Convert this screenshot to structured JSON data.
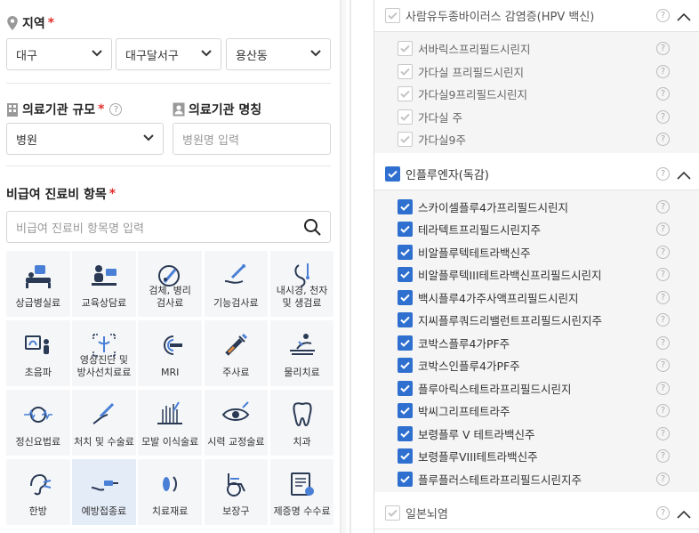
{
  "region": {
    "title": "지역",
    "required_mark": "*",
    "city": "대구",
    "district": "대구달서구",
    "dong": "용산동"
  },
  "facility": {
    "size_title": "의료기관 규모",
    "required_mark": "*",
    "size_value": "병원",
    "name_title": "의료기관 명칭",
    "name_placeholder": "병원명 입력"
  },
  "nonpay": {
    "title": "비급여 진료비 항목",
    "required_mark": "*",
    "search_placeholder": "비급여 진료비 항목명 입력",
    "categories": [
      {
        "label": "상급병실료",
        "icon": "hospital-bed-icon"
      },
      {
        "label": "교육상담료",
        "icon": "counseling-icon"
      },
      {
        "label": "검체, 병리\n검사료",
        "icon": "microscope-icon"
      },
      {
        "label": "기능검사료",
        "icon": "function-test-icon"
      },
      {
        "label": "내시경, 천자\n및 생검료",
        "icon": "endoscope-icon"
      },
      {
        "label": "초음파",
        "icon": "ultrasound-icon"
      },
      {
        "label": "영상진단 및\n방사선치료료",
        "icon": "xray-icon"
      },
      {
        "label": "MRI",
        "icon": "mri-icon"
      },
      {
        "label": "주사료",
        "icon": "syringe-icon"
      },
      {
        "label": "물리치료",
        "icon": "physical-therapy-icon"
      },
      {
        "label": "정신요법료",
        "icon": "brain-icon"
      },
      {
        "label": "처치 및 수술료",
        "icon": "surgery-icon"
      },
      {
        "label": "모발 이식술료",
        "icon": "hair-transplant-icon"
      },
      {
        "label": "시력 교정술료",
        "icon": "eye-icon"
      },
      {
        "label": "치과",
        "icon": "tooth-icon"
      },
      {
        "label": "한방",
        "icon": "acupuncture-icon"
      },
      {
        "label": "예방접종료",
        "icon": "vaccine-icon"
      },
      {
        "label": "치료재료",
        "icon": "medical-material-icon"
      },
      {
        "label": "보장구",
        "icon": "wheelchair-icon"
      },
      {
        "label": "제증명 수수료",
        "icon": "certificate-icon"
      }
    ]
  },
  "groups": [
    {
      "label": "사람유두종바이러스 감염증(HPV 백신)",
      "checked": false,
      "items": [
        "서바릭스프리필드시린지",
        "가다실 프리필드시린지",
        "가다실9프리필드시린지",
        "가다실 주",
        "가다실9주"
      ]
    },
    {
      "label": "인플루엔자(독감)",
      "checked": true,
      "items": [
        "스카이셀플루4가프리필드시린지",
        "테라텍트프리필드시린지주",
        "비알플루텍테트라백신주",
        "비알플루텍III테트라백신프리필드시린지",
        "백시플루4가주사액프리필드시린지",
        "지씨플루쿼드리밸런트프리필드시린지주",
        "코박스플루4가PF주",
        "코박스인플루4가PF주",
        "플루아릭스테트라프리필드시린지",
        "박씨그리프테트라주",
        "보령플루 V 테트라백신주",
        "보령플루VIII테트라백신주",
        "플루플러스테트라프리필드시린지주"
      ]
    },
    {
      "label": "일본뇌염",
      "checked": false,
      "items": []
    }
  ],
  "help_mark": "?",
  "colors": {
    "accent": "#2e6fd0",
    "required": "#e0312b",
    "tile_bg": "#f5f6f8",
    "tile_active": "#e4ecf8"
  }
}
